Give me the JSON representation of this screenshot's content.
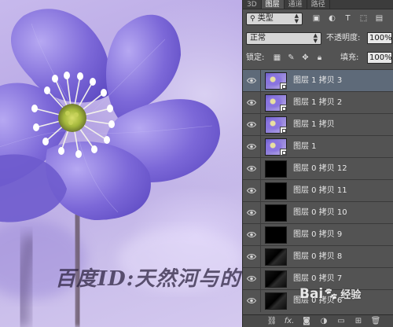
{
  "canvas": {
    "watermark": "百度ID:天然河与的",
    "image_description": "purple anemone flower photo"
  },
  "panel": {
    "tabs": [
      {
        "label": "3D",
        "active": false
      },
      {
        "label": "图层",
        "active": true
      },
      {
        "label": "通道",
        "active": false
      },
      {
        "label": "路径",
        "active": false
      }
    ],
    "filter": {
      "kind_label": "类型"
    },
    "blend": {
      "mode": "正常",
      "opacity_label": "不透明度:",
      "opacity_value": "100%"
    },
    "lock": {
      "label": "锁定:",
      "fill_label": "填充:",
      "fill_value": "100%"
    },
    "layers": [
      {
        "name": "图层 1 拷贝 3",
        "thumb": "photo",
        "selected": true
      },
      {
        "name": "图层 1 拷贝 2",
        "thumb": "photo",
        "selected": false
      },
      {
        "name": "图层 1 拷贝",
        "thumb": "photo",
        "selected": false
      },
      {
        "name": "图层 1",
        "thumb": "photo",
        "selected": false
      },
      {
        "name": "图层 0 拷贝 12",
        "thumb": "black",
        "selected": false
      },
      {
        "name": "图层 0 拷贝 11",
        "thumb": "black",
        "selected": false
      },
      {
        "name": "图层 0 拷贝 10",
        "thumb": "black",
        "selected": false
      },
      {
        "name": "图层 0 拷贝 9",
        "thumb": "black",
        "selected": false
      },
      {
        "name": "图层 0 拷贝 8",
        "thumb": "frame",
        "selected": false
      },
      {
        "name": "图层 0 拷贝 7",
        "thumb": "frame",
        "selected": false
      },
      {
        "name": "图层 0 拷贝 6",
        "thumb": "frame",
        "selected": false
      }
    ],
    "bottom_icons": [
      "link-icon",
      "fx-icon",
      "mask-icon",
      "adjustment-icon",
      "group-icon",
      "new-layer-icon",
      "trash-icon"
    ],
    "bottom_fx_label": "fx."
  },
  "overlay": {
    "brand": "Bai",
    "brand_suffix": "经验"
  },
  "colors": {
    "panel_bg": "#535353",
    "selected_row": "#5e6a79",
    "flower": "#7a66d6"
  }
}
